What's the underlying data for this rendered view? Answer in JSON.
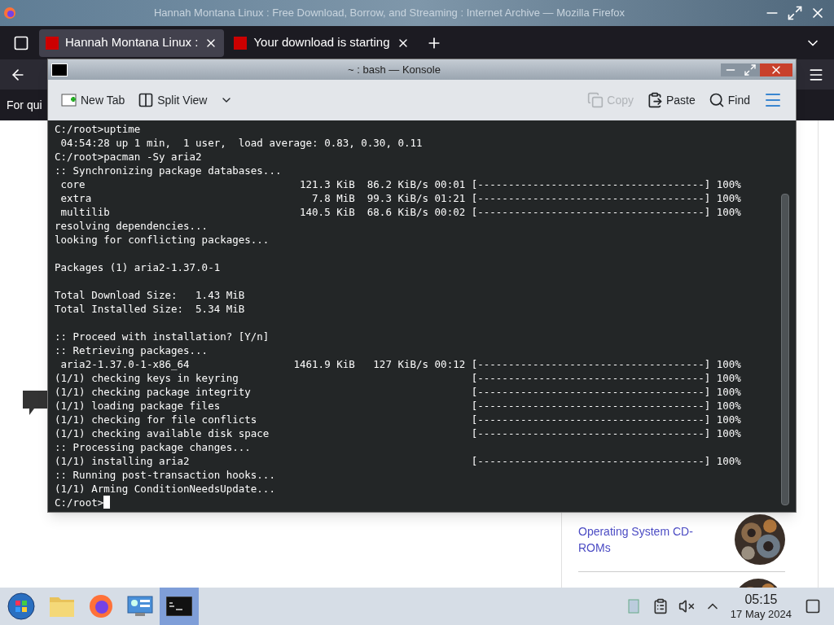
{
  "firefox": {
    "title": "Hannah Montana Linux : Free Download, Borrow, and Streaming : Internet Archive — Mozilla Firefox",
    "tabs": [
      {
        "label": "Hannah Montana Linux :",
        "selected": true
      },
      {
        "label": "Your download is starting",
        "selected": false
      }
    ],
    "notice": "For qui",
    "sidebar_link": "Operating System CD-ROMs"
  },
  "konsole": {
    "title": "~ : bash — Konsole",
    "toolbar": [
      {
        "label": "New Tab",
        "kind": "newtab",
        "disabled": false
      },
      {
        "label": "Split View",
        "kind": "split",
        "disabled": false
      },
      {
        "label": "Copy",
        "kind": "copy",
        "disabled": true
      },
      {
        "label": "Paste",
        "kind": "paste",
        "disabled": false
      },
      {
        "label": "Find",
        "kind": "find",
        "disabled": false
      }
    ],
    "cursor": true,
    "blocks": [
      [
        "C:/root>uptime",
        " 04:54:28 up 1 min,  1 user,  load average: 0.83, 0.30, 0.11",
        "C:/root>pacman -Sy aria2",
        ":: Synchronizing package databases...",
        " core                                   121.3 KiB  86.2 KiB/s 00:01 [-------------------------------------] 100%",
        " extra                                    7.8 MiB  99.3 KiB/s 01:21 [-------------------------------------] 100%",
        " multilib                               140.5 KiB  68.6 KiB/s 00:02 [-------------------------------------] 100%",
        "resolving dependencies...",
        "looking for conflicting packages..."
      ],
      [
        "Packages (1) aria2-1.37.0-1"
      ],
      [
        "Total Download Size:   1.43 MiB",
        "Total Installed Size:  5.34 MiB"
      ],
      [
        ":: Proceed with installation? [Y/n]",
        ":: Retrieving packages...",
        " aria2-1.37.0-1-x86_64                 1461.9 KiB   127 KiB/s 00:12 [-------------------------------------] 100%",
        "(1/1) checking keys in keyring                                      [-------------------------------------] 100%",
        "(1/1) checking package integrity                                    [-------------------------------------] 100%",
        "(1/1) loading package files                                         [-------------------------------------] 100%",
        "(1/1) checking for file conflicts                                   [-------------------------------------] 100%",
        "(1/1) checking available disk space                                 [-------------------------------------] 100%",
        ":: Processing package changes...",
        "(1/1) installing aria2                                              [-------------------------------------] 100%",
        ":: Running post-transaction hooks...",
        "(1/1) Arming ConditionNeedsUpdate...",
        "C:/root>"
      ]
    ]
  },
  "taskbar": {
    "apps": [
      {
        "kind": "folder",
        "selected": false
      },
      {
        "kind": "firefox",
        "selected": false
      },
      {
        "kind": "settings",
        "selected": false
      },
      {
        "kind": "terminal",
        "selected": true
      }
    ],
    "time": "05:15",
    "date": "17 May 2024"
  }
}
